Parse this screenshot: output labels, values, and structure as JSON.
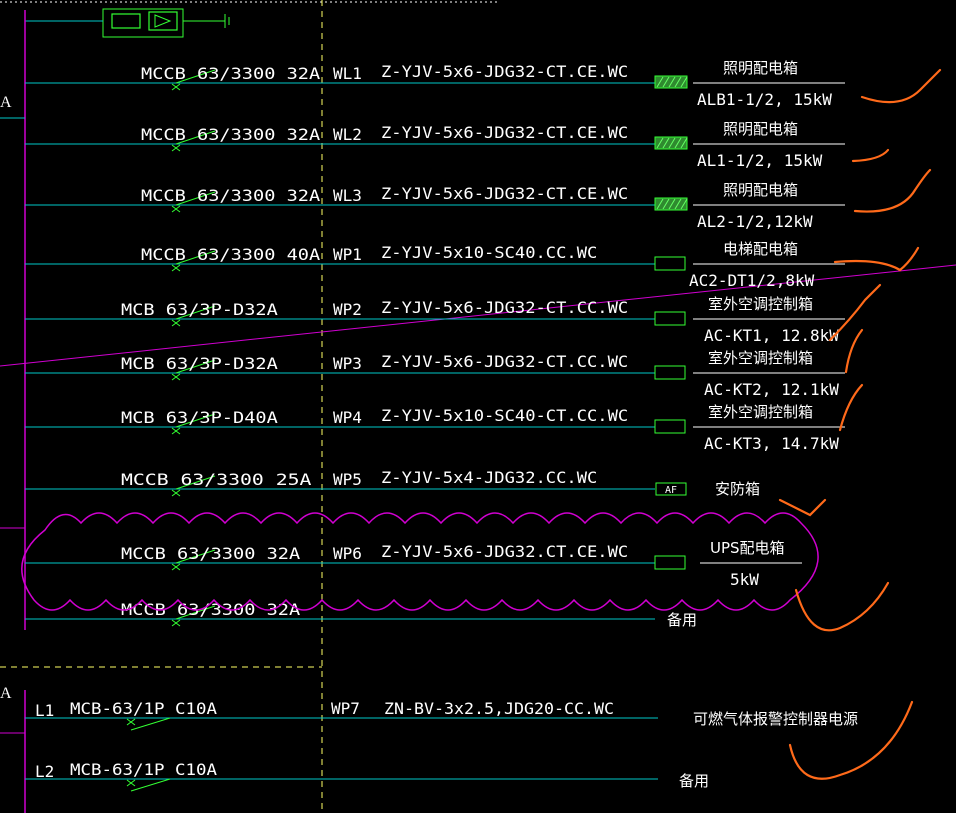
{
  "colors": {
    "background": "#000000",
    "feeder_line": "#00c8c8",
    "bus": "#d000d0",
    "divider": "#ffff66",
    "label": "#ffffff",
    "breaker_mark": "#33ff33",
    "redline": "#ff6a1a",
    "cloud": "#d000d0"
  },
  "header": {
    "left_bus_label_top": "A",
    "left_bus_label_bottom": "A"
  },
  "circuits": [
    {
      "breaker": "MCCB 63/3300 32A",
      "circuit": "WL1",
      "cable": "Z-YJV-5x6-JDG32-CT.CE.WC",
      "panel_name": "照明配电箱",
      "panel_load": "ALB1-1/2, 15kW",
      "box_style": "hatched"
    },
    {
      "breaker": "MCCB 63/3300 32A",
      "circuit": "WL2",
      "cable": "Z-YJV-5x6-JDG32-CT.CE.WC",
      "panel_name": "照明配电箱",
      "panel_load": "AL1-1/2, 15kW",
      "box_style": "hatched"
    },
    {
      "breaker": "MCCB 63/3300 32A",
      "circuit": "WL3",
      "cable": "Z-YJV-5x6-JDG32-CT.CE.WC",
      "panel_name": "照明配电箱",
      "panel_load": "AL2-1/2,12kW",
      "box_style": "hatched"
    },
    {
      "breaker": "MCCB 63/3300 40A",
      "circuit": "WP1",
      "cable": "Z-YJV-5x10-SC40.CC.WC",
      "panel_name": "电梯配电箱",
      "panel_load": "AC2-DT1/2,8kW",
      "box_style": "empty"
    },
    {
      "breaker": "MCB 63/3P-D32A",
      "circuit": "WP2",
      "cable": "Z-YJV-5x6-JDG32-CT.CC.WC",
      "panel_name": "室外空调控制箱",
      "panel_load": "AC-KT1, 12.8kW",
      "box_style": "empty"
    },
    {
      "breaker": "MCB 63/3P-D32A",
      "circuit": "WP3",
      "cable": "Z-YJV-5x6-JDG32-CT.CC.WC",
      "panel_name": "室外空调控制箱",
      "panel_load": "AC-KT2, 12.1kW",
      "box_style": "empty"
    },
    {
      "breaker": "MCB 63/3P-D40A",
      "circuit": "WP4",
      "cable": "Z-YJV-5x10-SC40-CT.CC.WC",
      "panel_name": "室外空调控制箱",
      "panel_load": "AC-KT3, 14.7kW",
      "box_style": "empty"
    },
    {
      "breaker": "MCCB 63/3300  25A",
      "circuit": "WP5",
      "cable": "Z-YJV-5x4-JDG32.CC.WC",
      "panel_name": "安防箱",
      "panel_load": "",
      "box_style": "af",
      "box_label": "AF"
    },
    {
      "breaker": "MCCB 63/3300 32A",
      "circuit": "WP6",
      "cable": "Z-YJV-5x6-JDG32.CT.CE.WC",
      "panel_name": "UPS配电箱",
      "panel_load": "5kW",
      "box_style": "empty"
    },
    {
      "breaker": "MCCB 63/3300 32A",
      "circuit": "",
      "cable": "",
      "panel_name": "备用",
      "panel_load": "",
      "box_style": "none"
    }
  ],
  "lower_circuits": [
    {
      "phase": "L1",
      "breaker": "MCB-63/1P C10A",
      "circuit": "WP7",
      "cable": "ZN-BV-3x2.5,JDG20-CC.WC",
      "panel_name": "可燃气体报警控制器电源"
    },
    {
      "phase": "L2",
      "breaker": "MCB-63/1P C10A",
      "circuit": "",
      "cable": "",
      "panel_name": "备用"
    }
  ]
}
